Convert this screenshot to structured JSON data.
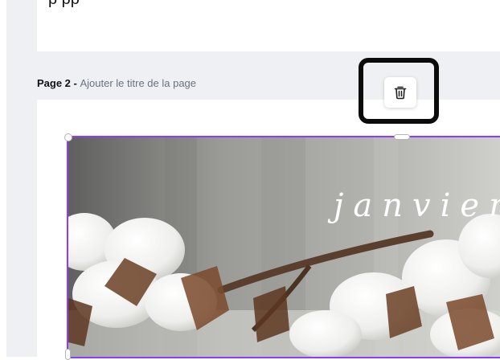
{
  "page1": {
    "partial_text": "p pp"
  },
  "page2": {
    "number_label": "Page 2 - ",
    "title_placeholder": "Ajouter le titre de la page"
  },
  "toolbar": {
    "delete_icon": "trash-icon"
  },
  "image": {
    "overlay_text": "janvier"
  },
  "colors": {
    "selection": "#8b3dff",
    "canvas_bg": "#eef0f3",
    "highlight": "#0b0b0b"
  }
}
